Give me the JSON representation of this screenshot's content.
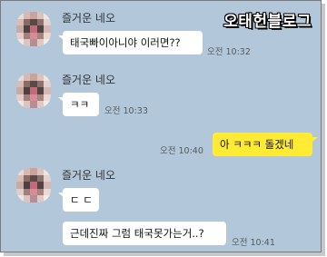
{
  "watermark": "오태헌블로그",
  "messages": [
    {
      "sender": "즐거운 네오",
      "text": "태국빠이아니야 이러면??",
      "time": "오전 10:32"
    },
    {
      "sender": "즐거운 네오",
      "text": "ㅋㅋ",
      "time": "오전 10:33"
    },
    {
      "text": "아 ㅋㅋㅋ 돌겠네",
      "time": "오전 10:40"
    },
    {
      "sender": "즐거운 네오",
      "text": "ㄷ ㄷ"
    },
    {
      "text": "근데진짜 그럼 태국못가는거..?",
      "time": "오전 10:41"
    }
  ],
  "colors": {
    "chat_background": "#b2c7d9",
    "my_bubble": "#ffeb33",
    "their_bubble": "#ffffff"
  }
}
